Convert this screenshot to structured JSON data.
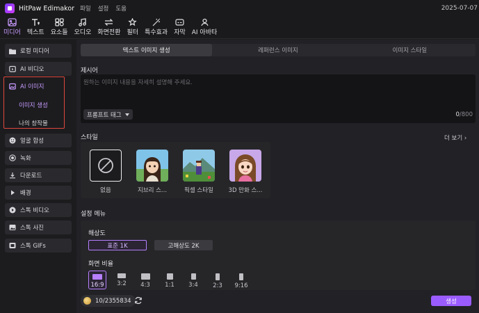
{
  "titlebar": {
    "app_name": "HitPaw Edimakor",
    "menu": [
      "파일",
      "설정",
      "도움"
    ],
    "date": "2025-07-07"
  },
  "toolbar": {
    "tools": [
      {
        "label": "미디어",
        "icon": "media-icon",
        "active": true
      },
      {
        "label": "텍스트",
        "icon": "text-icon"
      },
      {
        "label": "요소들",
        "icon": "elements-icon"
      },
      {
        "label": "오디오",
        "icon": "audio-icon"
      },
      {
        "label": "화면전환",
        "icon": "transition-icon"
      },
      {
        "label": "필터",
        "icon": "filter-icon"
      },
      {
        "label": "특수효과",
        "icon": "effects-icon"
      },
      {
        "label": "자막",
        "icon": "subtitle-icon"
      },
      {
        "label": "AI 아바타",
        "icon": "avatar-icon"
      }
    ]
  },
  "sidebar": {
    "items": [
      {
        "label": "로컬 미디어",
        "icon": "folder-icon"
      },
      {
        "label": "AI 비디오",
        "icon": "ai-video-icon"
      },
      {
        "label": "AI 이미지",
        "icon": "ai-image-icon"
      },
      {
        "label": "얼굴 합성",
        "icon": "face-swap-icon"
      },
      {
        "label": "녹화",
        "icon": "record-icon"
      },
      {
        "label": "다운로드",
        "icon": "download-icon"
      },
      {
        "label": "배경",
        "icon": "background-icon"
      },
      {
        "label": "스톡 비디오",
        "icon": "stock-video-icon"
      },
      {
        "label": "스톡 사진",
        "icon": "stock-photo-icon"
      },
      {
        "label": "스톡 GIFs",
        "icon": "gif-icon"
      }
    ],
    "ai_image_sub": [
      {
        "label": "이미지 생성",
        "active": true
      },
      {
        "label": "나의 창작물"
      }
    ]
  },
  "main": {
    "tabs": [
      {
        "label": "텍스트 이미지 생성",
        "active": true
      },
      {
        "label": "레퍼런스 이미지"
      },
      {
        "label": "이미지 스타일"
      }
    ],
    "prompt": {
      "label": "제시어",
      "placeholder": "원하는 이미지 내용을 자세히 설명해 주세요.",
      "tag_button": "프롬프트 태그",
      "count": "0",
      "max": "/800"
    },
    "style": {
      "label": "스타일",
      "more": "더 보기",
      "options": [
        {
          "label": "없음",
          "selected": true
        },
        {
          "label": "지브리 스..."
        },
        {
          "label": "픽셀 스타일"
        },
        {
          "label": "3D 만화 스..."
        }
      ]
    },
    "settings": {
      "label": "설정 메뉴",
      "resolution_label": "해상도",
      "resolutions": [
        {
          "label": "표준 1K",
          "active": true
        },
        {
          "label": "고해상도 2K"
        }
      ],
      "ratio_label": "화면 비율",
      "ratios": [
        {
          "label": "16:9",
          "active": true
        },
        {
          "label": "3:2"
        },
        {
          "label": "4:3"
        },
        {
          "label": "1:1"
        },
        {
          "label": "3:4"
        },
        {
          "label": "2:3"
        },
        {
          "label": "9:16"
        }
      ]
    },
    "footer": {
      "credits_used": "10",
      "credits_total": "/2355834",
      "generate": "생성"
    }
  },
  "colors": {
    "accent": "#9b5cff",
    "accent_text": "#c99bff",
    "highlight_border": "#e0473c"
  }
}
